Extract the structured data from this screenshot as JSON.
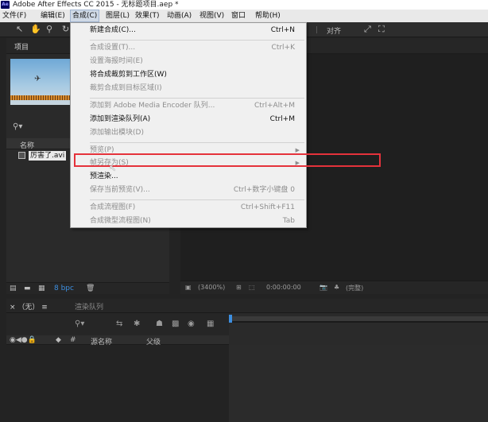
{
  "window": {
    "title": "Adobe After Effects CC 2015 - 无标题项目.aep *",
    "app_icon": "Ae"
  },
  "menubar": {
    "items": [
      {
        "label": "文件(F)"
      },
      {
        "label": "编辑(E)"
      },
      {
        "label": "合成(C)"
      },
      {
        "label": "图层(L)"
      },
      {
        "label": "效果(T)"
      },
      {
        "label": "动画(A)"
      },
      {
        "label": "视图(V)"
      },
      {
        "label": "窗口"
      },
      {
        "label": "帮助(H)"
      }
    ],
    "active_index": 2
  },
  "toolbar": {
    "align_label": "对齐"
  },
  "project": {
    "tab_label": "项目",
    "column_name": "名称",
    "file_name": "厉害了.avi",
    "bpc_label": "8 bpc"
  },
  "viewer": {
    "zoom": "(3400%)",
    "timecode": "0:00:00:00",
    "quality": "(完整)"
  },
  "timeline": {
    "tab_label": "（无）",
    "render_queue_label": "渲染队列",
    "source_name_header": "源名称",
    "parent_header": "父级"
  },
  "composition_menu": {
    "items": [
      {
        "label": "新建合成(C)...",
        "shortcut": "Ctrl+N",
        "enabled": true
      },
      {
        "separator": true
      },
      {
        "label": "合成设置(T)...",
        "shortcut": "Ctrl+K",
        "enabled": false
      },
      {
        "label": "设置海报时间(E)",
        "shortcut": "",
        "enabled": false
      },
      {
        "label": "将合成裁剪到工作区(W)",
        "shortcut": "",
        "enabled": true
      },
      {
        "label": "裁剪合成到目标区域(I)",
        "shortcut": "",
        "enabled": false
      },
      {
        "separator": true
      },
      {
        "label": "添加到 Adobe Media Encoder 队列...",
        "shortcut": "Ctrl+Alt+M",
        "enabled": false
      },
      {
        "label": "添加到渲染队列(A)",
        "shortcut": "Ctrl+M",
        "enabled": true
      },
      {
        "label": "添加输出模块(D)",
        "shortcut": "",
        "enabled": false
      },
      {
        "separator": true
      },
      {
        "label": "预览(P)",
        "shortcut": "",
        "enabled": false,
        "submenu": true
      },
      {
        "label": "帧另存为(S)",
        "shortcut": "",
        "enabled": false,
        "submenu": true,
        "highlighted": true
      },
      {
        "label": "预渲染...",
        "shortcut": "",
        "enabled": true
      },
      {
        "label": "保存当前预览(V)...",
        "shortcut": "Ctrl+数字小键盘 0",
        "enabled": false
      },
      {
        "separator": true
      },
      {
        "label": "合成流程图(F)",
        "shortcut": "Ctrl+Shift+F11",
        "enabled": false
      },
      {
        "label": "合成微型流程图(N)",
        "shortcut": "Tab",
        "enabled": false
      }
    ]
  },
  "colors": {
    "highlight_box": "#e5323b",
    "accent_blue": "#3d8fe0"
  }
}
